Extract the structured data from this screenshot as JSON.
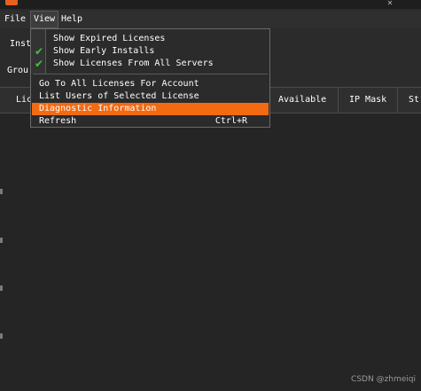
{
  "menubar": {
    "items": [
      {
        "label": "File"
      },
      {
        "label": "View"
      },
      {
        "label": "Help"
      }
    ]
  },
  "toolbar": {
    "install_label": "Inst",
    "group_label": "Grou"
  },
  "table": {
    "headers": [
      "Lic",
      "Available",
      "IP Mask",
      "St"
    ]
  },
  "view_menu": {
    "top_items": [
      {
        "label": "Show Expired Licenses",
        "checked": false
      },
      {
        "label": "Show Early Installs",
        "checked": true
      },
      {
        "label": "Show Licenses From All Servers",
        "checked": true
      }
    ],
    "bottom_items": [
      {
        "label": "Go To All Licenses For Account",
        "shortcut": ""
      },
      {
        "label": "List Users of Selected License",
        "shortcut": ""
      },
      {
        "label": "Diagnostic Information",
        "shortcut": "",
        "highlighted": true
      },
      {
        "label": "Refresh",
        "shortcut": "Ctrl+R"
      }
    ]
  },
  "watermark": "CSDN @zhmeiqi",
  "colors": {
    "highlight": "#f26a12",
    "check": "#3ec63e",
    "background": "#2b2b2b"
  },
  "icons": {
    "check": "checkmark-icon"
  }
}
